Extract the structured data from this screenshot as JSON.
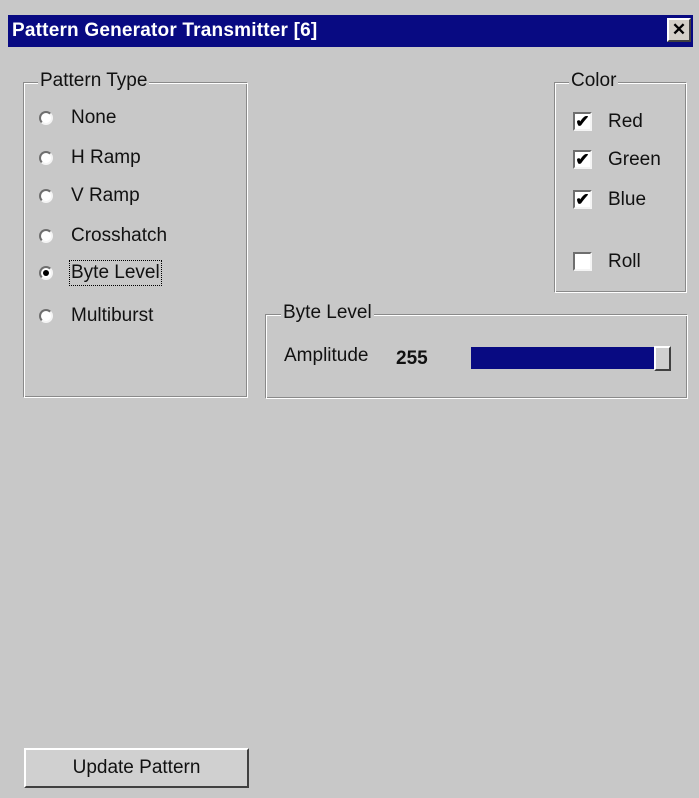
{
  "window": {
    "title": "Pattern Generator Transmitter [6]"
  },
  "pattern_type": {
    "label": "Pattern Type",
    "options": [
      {
        "label": "None",
        "selected": false
      },
      {
        "label": "H Ramp",
        "selected": false
      },
      {
        "label": "V Ramp",
        "selected": false
      },
      {
        "label": "Crosshatch",
        "selected": false
      },
      {
        "label": "Byte Level",
        "selected": true
      },
      {
        "label": "Multiburst",
        "selected": false
      }
    ]
  },
  "color": {
    "label": "Color",
    "items": [
      {
        "label": "Red",
        "checked": true
      },
      {
        "label": "Green",
        "checked": true
      },
      {
        "label": "Blue",
        "checked": true
      },
      {
        "label": "Roll",
        "checked": false
      }
    ]
  },
  "byte_level": {
    "label": "Byte Level",
    "amplitude_label": "Amplitude",
    "amplitude_value": "255",
    "amplitude_fraction": 1.0
  },
  "actions": {
    "update_label": "Update Pattern"
  },
  "colors": {
    "titlebar": "#080a82",
    "slider_fill": "#080a82",
    "face": "#c8c8c8"
  },
  "icons": {
    "close": "close-icon"
  }
}
